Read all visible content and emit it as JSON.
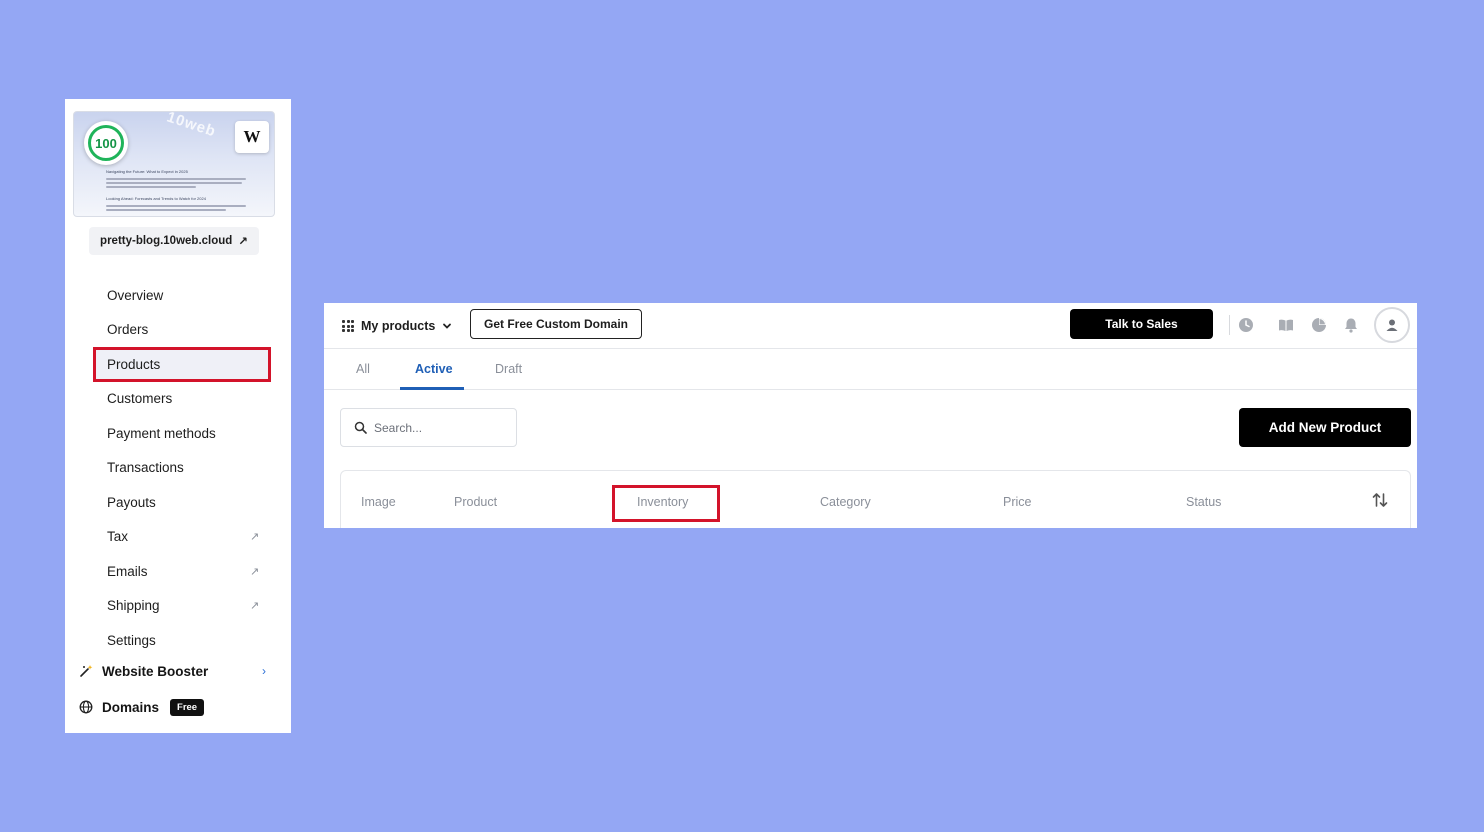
{
  "sidebar": {
    "thumbnail": {
      "score": "100",
      "logo_letter": "W",
      "watermark": "10web",
      "heading_1": "Navigating the Future: What to Expect in 2025",
      "heading_2": "Looking Ahead: Forecasts and Trends to Watch for 2024"
    },
    "domain_link": "pretty-blog.10web.cloud",
    "items": [
      {
        "label": "Overview"
      },
      {
        "label": "Orders"
      },
      {
        "label": "Products"
      },
      {
        "label": "Customers"
      },
      {
        "label": "Payment methods"
      },
      {
        "label": "Transactions"
      },
      {
        "label": "Payouts"
      },
      {
        "label": "Tax"
      },
      {
        "label": "Emails"
      },
      {
        "label": "Shipping"
      },
      {
        "label": "Settings"
      }
    ],
    "booster_label": "Website Booster",
    "domains_label": "Domains",
    "domains_badge": "Free"
  },
  "topbar": {
    "menu_label": "My products",
    "custom_domain_button": "Get Free Custom Domain",
    "talk_to_sales_button": "Talk to Sales"
  },
  "tabs": [
    {
      "label": "All"
    },
    {
      "label": "Active"
    },
    {
      "label": "Draft"
    }
  ],
  "search": {
    "placeholder": "Search..."
  },
  "add_button": "Add New Product",
  "table": {
    "columns": [
      "Image",
      "Product",
      "Inventory",
      "Category",
      "Price",
      "Status"
    ]
  },
  "colors": {
    "background": "#94a7f4",
    "highlight": "#d3132a",
    "active_tab": "#1f5fb6",
    "score_green": "#1fb45a"
  }
}
